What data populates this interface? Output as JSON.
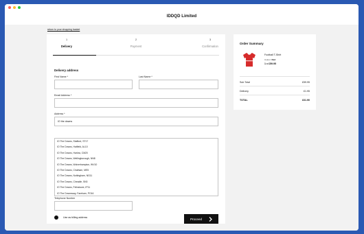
{
  "window": {
    "dots": [
      "#ff5f57",
      "#febc2e",
      "#28c840"
    ],
    "store_name": "IDDQD Limited"
  },
  "return_link": "return to your shopping basket",
  "steps": [
    {
      "num": "1",
      "label": "Delivery"
    },
    {
      "num": "2",
      "label": "Payment"
    },
    {
      "num": "3",
      "label": "Confirmation"
    }
  ],
  "form": {
    "section_title": "Delivery address",
    "first_name_label": "First Name *",
    "last_name_label": "Last Name *",
    "email_label": "Email Address *",
    "address_label": "Address *",
    "address_value": "IO the downs",
    "suggestions": [
      "IO The Downs, Stafford, ST17",
      "IO The Downs, Hatfield, AL10",
      "IO The Downs, Harlow, CM20",
      "IO The Downs, Wellingborough, NN8",
      "IO The Downs, Wolverhampton, WV10",
      "IO The Downs, Chatham, ME5",
      "IO The Downs, Nottingham, NG11",
      "IO The Downs, Cheadle, SK8",
      "IO The Downs, Felixstowe, IP11",
      "IO The Downsway, Fareham, PO16"
    ],
    "telephone_label": "Telephone Number",
    "billing_label": "Use as billing address",
    "proceed_label": "Proceed"
  },
  "summary": {
    "title": "Order Summary",
    "product_name": "Football T-Shirt",
    "colour_label": "Colour:",
    "colour_value": "Red",
    "product_price": "1 x £59.95",
    "subtotal_label": "Sub Total",
    "subtotal_value": "£59.95",
    "delivery_label": "Delivery",
    "delivery_value": "£1.95",
    "total_label": "TOTAL",
    "total_value": "£61.90"
  },
  "colors": {
    "background": "#2a59b3",
    "shirt_red": "#d62b2b",
    "button": "#111111"
  },
  "icons": {
    "proceed": "chevron-right-icon",
    "product": "tshirt-image"
  }
}
